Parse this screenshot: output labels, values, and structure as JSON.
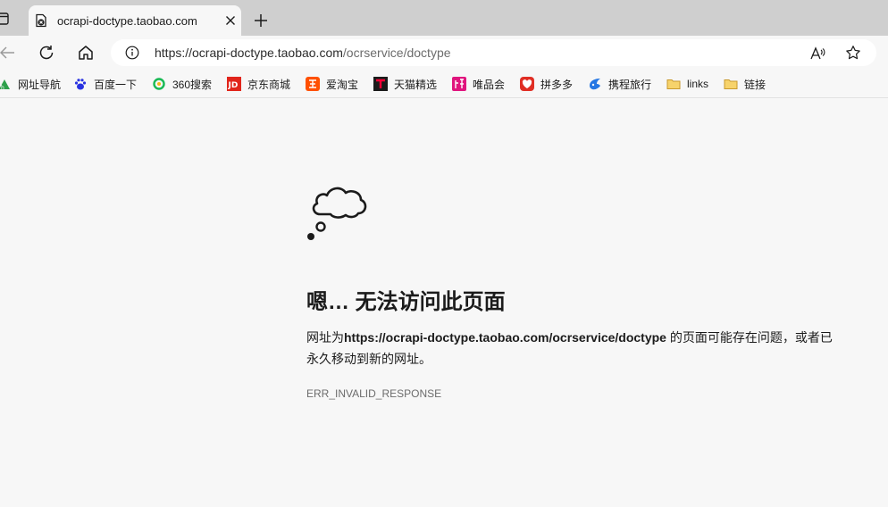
{
  "tab": {
    "title": "ocrapi-doctype.taobao.com",
    "favicon": "page-error-icon"
  },
  "toolbar": {
    "url_host": "https://ocrapi-doctype.taobao.com",
    "url_path": "/ocrservice/doctype",
    "icons": [
      "back-icon",
      "refresh-icon",
      "home-icon",
      "info-icon",
      "read-aloud-icon",
      "favorite-star-icon"
    ]
  },
  "bookmarks": [
    {
      "label": "网址导航",
      "icon": "hao123-icon",
      "color": "#2ea04b"
    },
    {
      "label": "百度一下",
      "icon": "baidu-paw-icon",
      "color": "#2932e1"
    },
    {
      "label": "360搜索",
      "icon": "360-search-icon",
      "color": "#19b955"
    },
    {
      "label": "京东商城",
      "icon": "jd-icon",
      "color": "#e1251b"
    },
    {
      "label": "爱淘宝",
      "icon": "taobao-icon",
      "color": "#ff5000"
    },
    {
      "label": "天猫精选",
      "icon": "tmall-icon",
      "color": "#1b1b1b"
    },
    {
      "label": "唯品会",
      "icon": "vip-icon",
      "color": "#e0157e"
    },
    {
      "label": "拼多多",
      "icon": "pinduoduo-icon",
      "color": "#e02e24"
    },
    {
      "label": "携程旅行",
      "icon": "ctrip-icon",
      "color": "#2577e3"
    },
    {
      "label": "links",
      "icon": "folder-icon",
      "color": "#f0c44c"
    },
    {
      "label": "链接",
      "icon": "folder-icon",
      "color": "#f0c44c"
    }
  ],
  "error": {
    "title": "嗯… 无法访问此页面",
    "desc_prefix": "网址为",
    "desc_url": "https://ocrapi-doctype.taobao.com/ocrservice/doctype",
    "desc_suffix": " 的页面可能存在问题，或者已永久移动到新的网址。",
    "code": "ERR_INVALID_RESPONSE"
  }
}
